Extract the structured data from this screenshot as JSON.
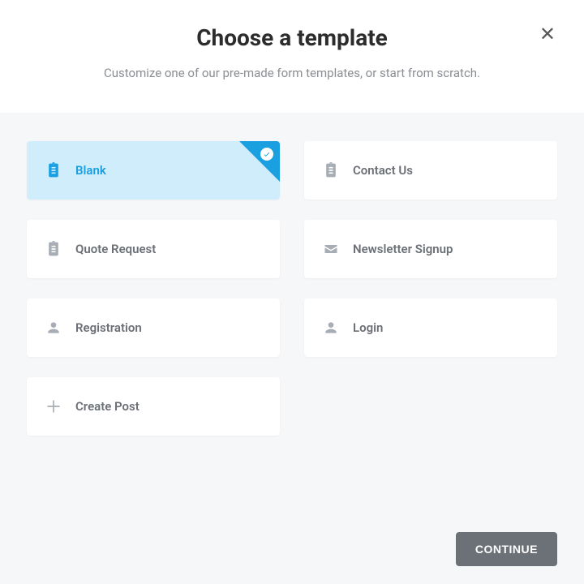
{
  "header": {
    "title": "Choose a template",
    "subtitle": "Customize one of our pre-made form templates, or start from scratch."
  },
  "templates": [
    {
      "label": "Blank",
      "icon": "clipboard",
      "selected": true
    },
    {
      "label": "Contact Us",
      "icon": "clipboard",
      "selected": false
    },
    {
      "label": "Quote Request",
      "icon": "clipboard",
      "selected": false
    },
    {
      "label": "Newsletter Signup",
      "icon": "envelope",
      "selected": false
    },
    {
      "label": "Registration",
      "icon": "person",
      "selected": false
    },
    {
      "label": "Login",
      "icon": "person",
      "selected": false
    },
    {
      "label": "Create Post",
      "icon": "plus",
      "selected": false
    }
  ],
  "footer": {
    "continue_label": "CONTINUE"
  }
}
